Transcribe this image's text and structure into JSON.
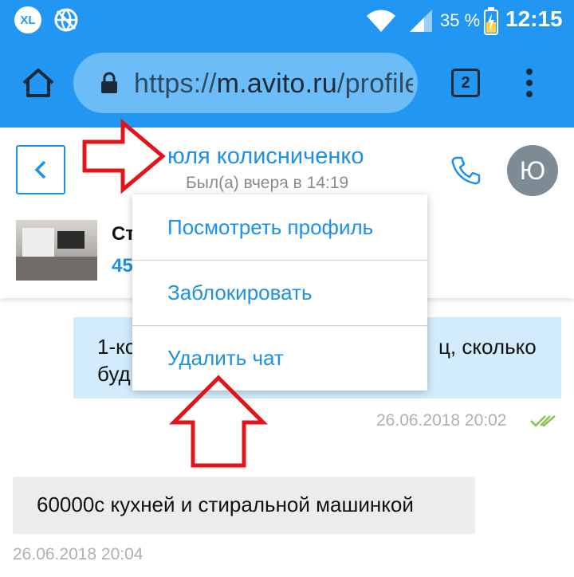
{
  "status_bar": {
    "notif_badge": "XL",
    "battery_percent": "35 %",
    "time": "12:15"
  },
  "browser": {
    "url_scheme": "https://",
    "url_domain": "m.avito.ru",
    "url_path": "/profile",
    "tab_count": "2"
  },
  "chat_header": {
    "user_name": "юля колисниченко",
    "last_seen": "Был(а) вчера в 14:19",
    "avatar_letter": "Ю"
  },
  "item": {
    "title_partial": "Ст",
    "price_partial": "45"
  },
  "menu": {
    "items": [
      {
        "label": "Посмотреть профиль"
      },
      {
        "label": "Заблокировать"
      },
      {
        "label": "Удалить чат"
      }
    ]
  },
  "messages": [
    {
      "text_left": "1-ко\nбуд",
      "text_right": "ц, сколько",
      "time": "26.06.2018 20:02",
      "outgoing": true
    },
    {
      "text": "60000с кухней и стиральной машинкой",
      "time": "26.06.2018 20:04",
      "outgoing": false
    }
  ],
  "colors": {
    "accent": "#2196f3",
    "link": "#1e90e6",
    "outgoing_bubble": "#d3ecfb",
    "incoming_bubble": "#ececec",
    "annotation_arrow": "#e2141b",
    "read_check": "#8bc34a"
  }
}
